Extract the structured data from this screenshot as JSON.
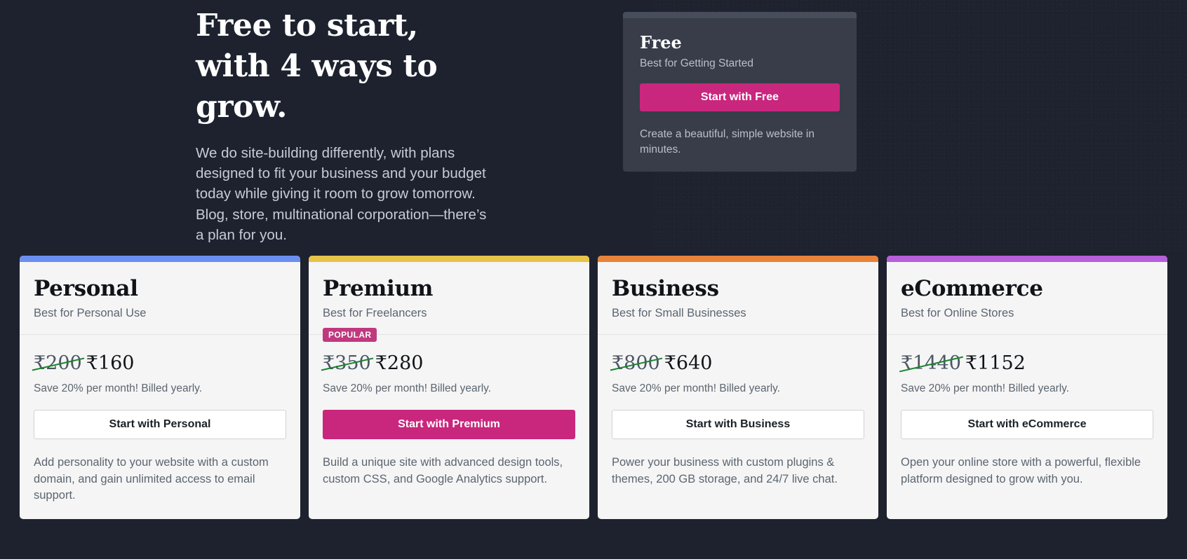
{
  "hero": {
    "headline": "Free to start,\nwith 4 ways to grow.",
    "paragraph": "We do site-building differently, with plans designed to fit your business and your budget today while giving it room to grow tomorrow. Blog, store, multinational corporation—there’s a plan for you."
  },
  "free_card": {
    "title": "Free",
    "tagline": "Best for Getting Started",
    "cta_label": "Start with Free",
    "description": "Create a beautiful, simple website in minutes.",
    "accent": "#474d5b",
    "cta_color": "#c9267d"
  },
  "plans": [
    {
      "name": "Personal",
      "tagline": "Best for Personal Use",
      "badge": "",
      "price_old": "₹200",
      "price_new": "₹160",
      "price_note": "Save 20% per month! Billed yearly.",
      "cta_label": "Start with Personal",
      "cta_style": "secondary",
      "description": "Add personality to your website with a custom domain, and gain unlimited access to email support.",
      "accent": "#6b8ff0"
    },
    {
      "name": "Premium",
      "tagline": "Best for Freelancers",
      "badge": "POPULAR",
      "price_old": "₹350",
      "price_new": "₹280",
      "price_note": "Save 20% per month! Billed yearly.",
      "cta_label": "Start with Premium",
      "cta_style": "primary",
      "description": "Build a unique site with advanced design tools, custom CSS, and Google Analytics support.",
      "accent": "#e7c34a"
    },
    {
      "name": "Business",
      "tagline": "Best for Small Businesses",
      "badge": "",
      "price_old": "₹800",
      "price_new": "₹640",
      "price_note": "Save 20% per month! Billed yearly.",
      "cta_label": "Start with Business",
      "cta_style": "secondary",
      "description": "Power your business with custom plugins & themes, 200 GB storage, and 24/7 live chat.",
      "accent": "#e8833a"
    },
    {
      "name": "eCommerce",
      "tagline": "Best for Online Stores",
      "badge": "",
      "price_old": "₹1440",
      "price_new": "₹1152",
      "price_note": "Save 20% per month! Billed yearly.",
      "cta_label": "Start with eCommerce",
      "cta_style": "secondary",
      "description": "Open your online store with a powerful, flexible platform designed to grow with you.",
      "accent": "#b75fdb"
    }
  ],
  "colors": {
    "page_background": "#1d222e",
    "card_background": "#f5f5f5",
    "free_card_background": "#383d49",
    "brand_pink": "#c9267d",
    "strikethrough_green": "#17852f"
  }
}
